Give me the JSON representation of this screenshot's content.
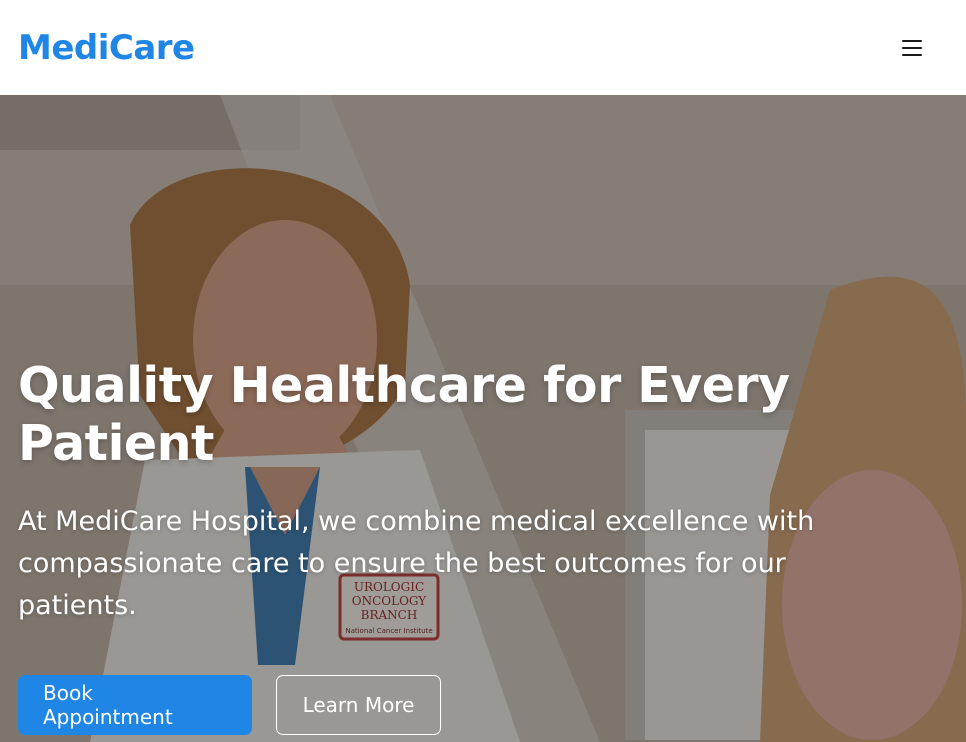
{
  "header": {
    "logo": "MediCare",
    "menu_icon": "hamburger-menu-icon"
  },
  "hero": {
    "title": "Quality Healthcare for Every Patient",
    "description": "At MediCare Hospital, we combine medical excellence with compassionate care to ensure the best outcomes for our patients.",
    "badge_line1": "UROLOGIC",
    "badge_line2": "ONCOLOGY",
    "badge_line3": "BRANCH",
    "badge_line4": "National Cancer Institute",
    "primary_button": "Book Appointment",
    "secondary_button": "Learn More"
  },
  "colors": {
    "brand": "#1f86e6",
    "hero_text": "#ffffff"
  }
}
